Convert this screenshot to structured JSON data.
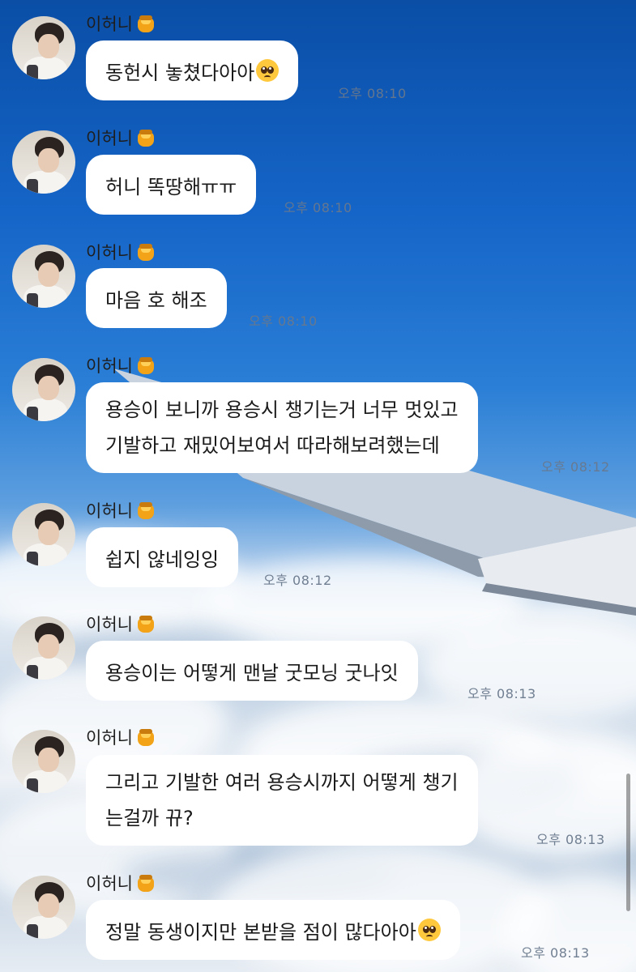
{
  "chat": {
    "messages": [
      {
        "sender": "이허니",
        "text": "동헌시 놓쳤다아아",
        "emoji": "pleading-face-icon",
        "time": "오후 08:10"
      },
      {
        "sender": "이허니",
        "text": "허니 똑땅해ㅠㅠ",
        "time": "오후 08:10"
      },
      {
        "sender": "이허니",
        "text": "마음 호 해조",
        "time": "오후 08:10"
      },
      {
        "sender": "이허니",
        "line1": "용승이 보니까 용승시 챙기는거 너무 멋있고",
        "line2": "기발하고 재밌어보여서 따라해보려했는데",
        "time": "오후 08:12"
      },
      {
        "sender": "이허니",
        "text": "쉽지 않네잉잉",
        "time": "오후 08:12"
      },
      {
        "sender": "이허니",
        "text": "용승이는 어떻게 맨날 굿모닝 굿나잇",
        "time": "오후 08:13"
      },
      {
        "sender": "이허니",
        "line1": "그리고 기발한 여러 용승시까지 어떻게 챙기",
        "line2": "는걸까 뀨?",
        "time": "오후 08:13"
      },
      {
        "sender": "이허니",
        "text": "정말 동생이지만 본받을 점이 많다아아",
        "emoji": "pleading-face-icon",
        "time": "오후 08:13"
      }
    ]
  },
  "colors": {
    "sky_top": "#0a4ea6",
    "bubble": "#ffffff",
    "text": "#1a1a1a",
    "timestamp": "#69788c"
  }
}
